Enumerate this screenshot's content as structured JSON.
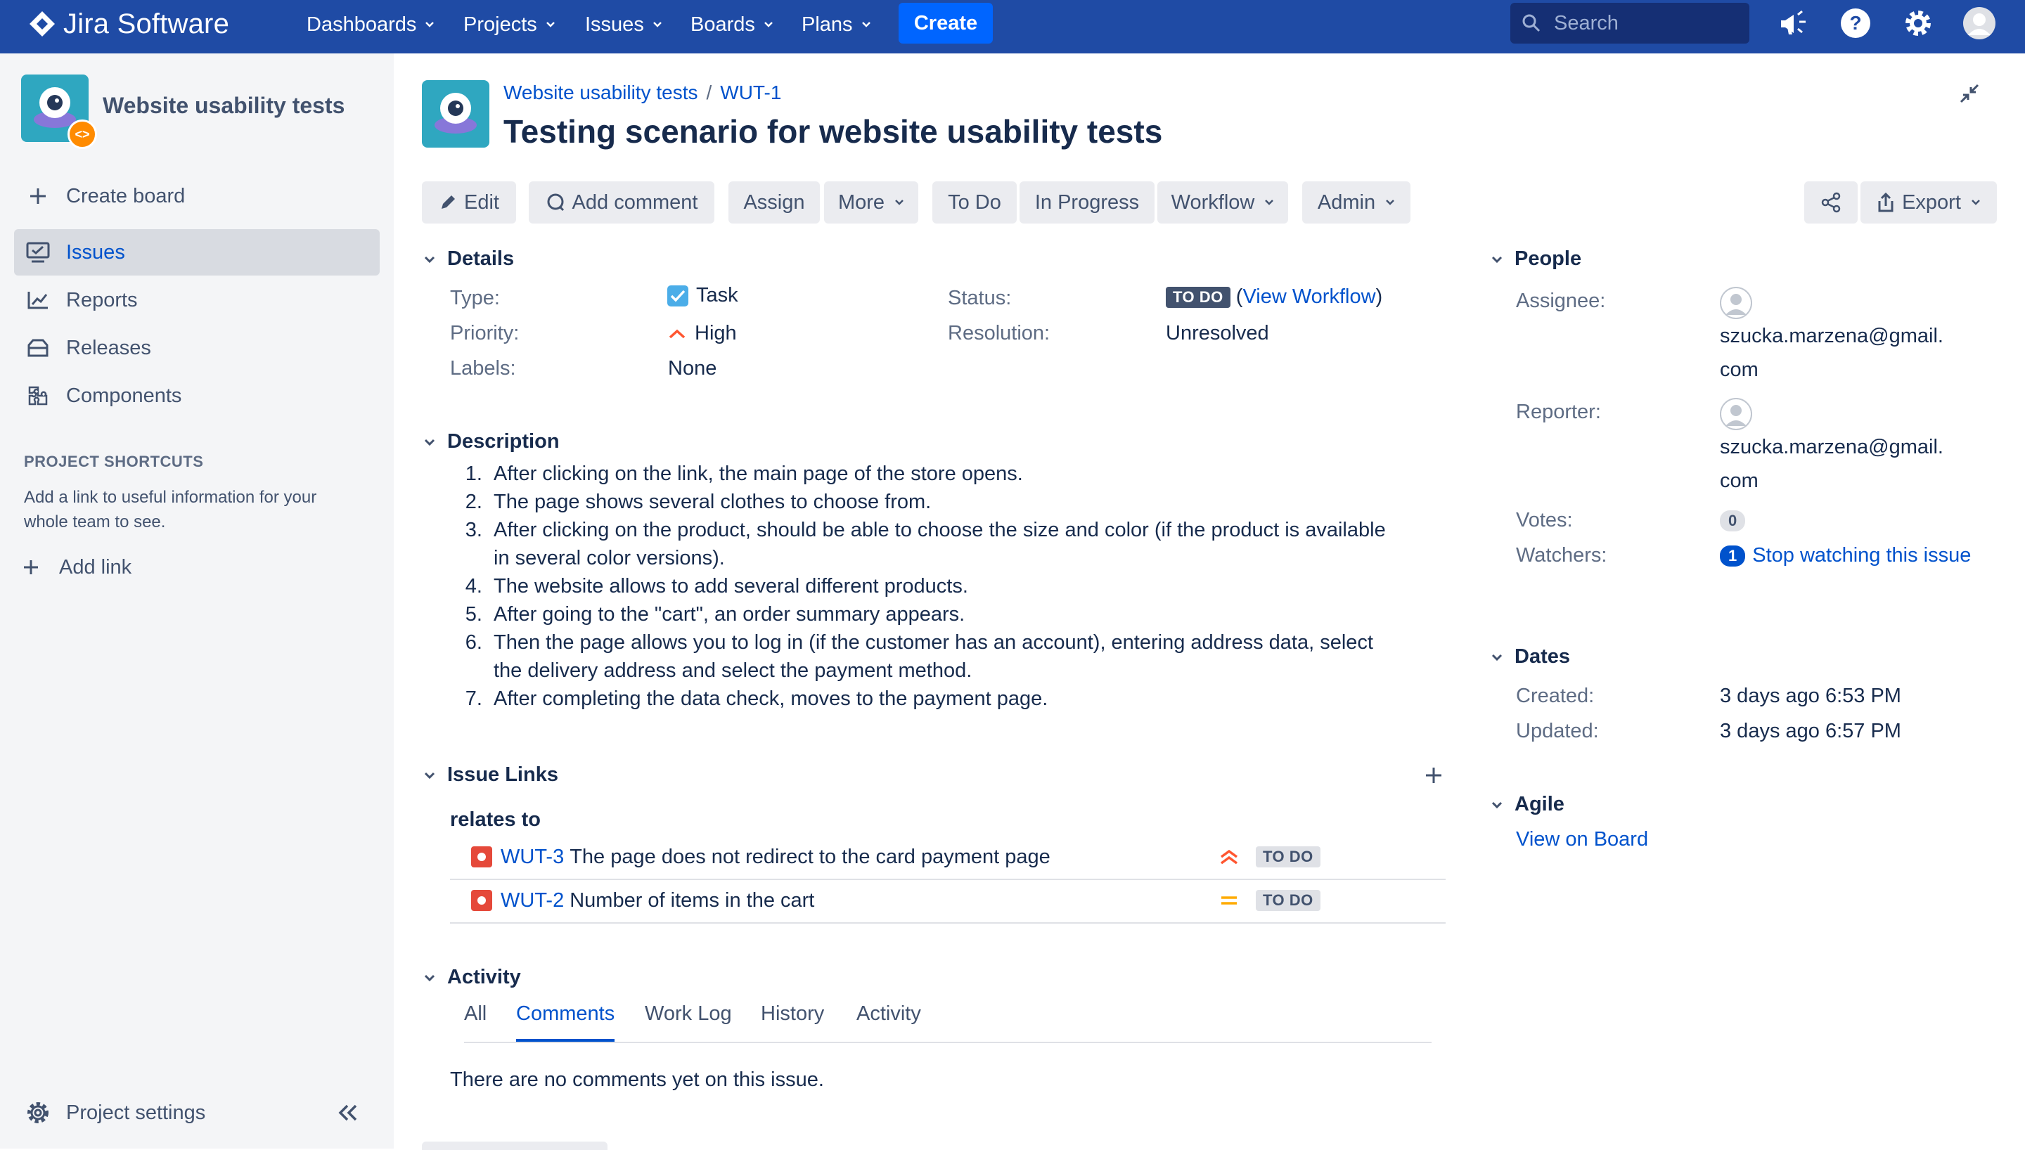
{
  "topnav": {
    "product": "Jira Software",
    "items": [
      {
        "label": "Dashboards"
      },
      {
        "label": "Projects"
      },
      {
        "label": "Issues"
      },
      {
        "label": "Boards"
      },
      {
        "label": "Plans"
      }
    ],
    "create_label": "Create",
    "search_placeholder": "Search",
    "icons": [
      "notifications-icon",
      "help-icon",
      "settings-icon",
      "profile-avatar"
    ]
  },
  "sidebar": {
    "project_name": "Website usability tests",
    "create_board": "Create board",
    "items": [
      {
        "label": "Issues",
        "icon": "issues-icon",
        "active": true
      },
      {
        "label": "Reports",
        "icon": "reports-icon"
      },
      {
        "label": "Releases",
        "icon": "releases-icon"
      },
      {
        "label": "Components",
        "icon": "components-icon"
      }
    ],
    "shortcuts_heading": "PROJECT SHORTCUTS",
    "shortcuts_note": "Add a link to useful information for your whole team to see.",
    "add_link": "Add link",
    "project_settings": "Project settings"
  },
  "issue": {
    "breadcrumb_project": "Website usability tests",
    "breadcrumb_separator": "/",
    "key": "WUT-1",
    "title": "Testing scenario for website usability tests"
  },
  "toolbar": {
    "edit": "Edit",
    "add_comment": "Add comment",
    "assign": "Assign",
    "more": "More",
    "to_do": "To Do",
    "in_progress": "In Progress",
    "workflow": "Workflow",
    "admin": "Admin",
    "export": "Export"
  },
  "details": {
    "heading": "Details",
    "type_label": "Type:",
    "type_value": "Task",
    "priority_label": "Priority:",
    "priority_value": "High",
    "labels_label": "Labels:",
    "labels_value": "None",
    "status_label": "Status:",
    "status_value": "TO DO",
    "view_workflow": "View Workflow",
    "paren_open": "(",
    "paren_close": ")",
    "resolution_label": "Resolution:",
    "resolution_value": "Unresolved"
  },
  "description": {
    "heading": "Description",
    "items": [
      "After clicking on the link, the main page of the store opens.",
      "The page shows several clothes to choose from.",
      "After clicking on the product, should be able to choose the size and color (if the product is available in several color versions).",
      "The website allows to add several different products.",
      "After going to the \"cart\", an order summary appears.",
      "Then the page allows you to log in (if the customer has an account), entering address data, select the delivery address and select the payment method.",
      "After completing the data check, moves to the payment page."
    ]
  },
  "issue_links": {
    "heading": "Issue Links",
    "relation": "relates to",
    "links": [
      {
        "key": "WUT-3",
        "summary": "The page does not redirect to the card payment page",
        "priority": "highest",
        "status": "TO DO"
      },
      {
        "key": "WUT-2",
        "summary": "Number of items in the cart",
        "priority": "medium",
        "status": "TO DO"
      }
    ]
  },
  "activity": {
    "heading": "Activity",
    "tabs": [
      "All",
      "Comments",
      "Work Log",
      "History",
      "Activity"
    ],
    "active_tab": "Comments",
    "empty": "There are no comments yet on this issue."
  },
  "people": {
    "heading": "People",
    "assignee_label": "Assignee:",
    "assignee_line1": "szucka.marzena@gmail.",
    "assignee_line2": "com",
    "reporter_label": "Reporter:",
    "reporter_line1": "szucka.marzena@gmail.",
    "reporter_line2": "com",
    "votes_label": "Votes:",
    "votes": "0",
    "watchers_label": "Watchers:",
    "watchers": "1",
    "stop_watching": "Stop watching this issue"
  },
  "dates": {
    "heading": "Dates",
    "created_label": "Created:",
    "created": "3 days ago 6:53 PM",
    "updated_label": "Updated:",
    "updated": "3 days ago 6:57 PM"
  },
  "agile": {
    "heading": "Agile",
    "view_on_board": "View on Board"
  },
  "colors": {
    "nav": "#1f4ba5",
    "create": "#0065ff",
    "link": "#0052cc",
    "sidebar": "#f4f5f7",
    "bug": "#e5493a",
    "priority_high": "#ff5630",
    "priority_medium": "#ffab00"
  }
}
